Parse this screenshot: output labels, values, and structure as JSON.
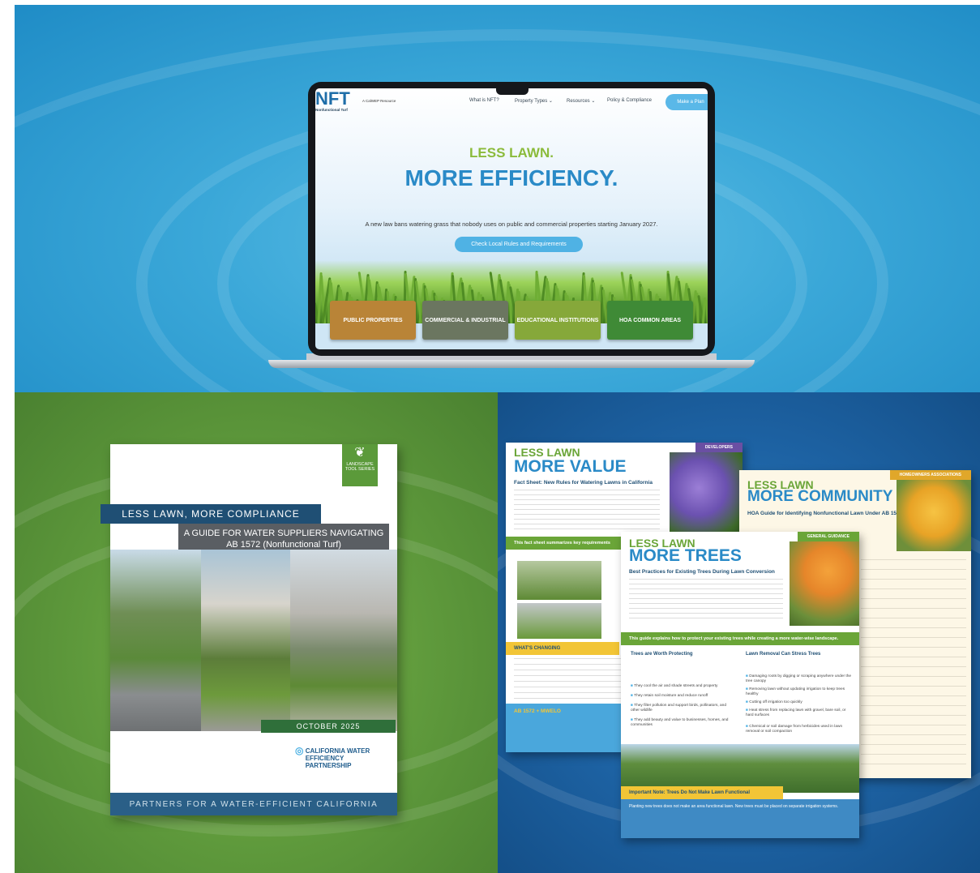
{
  "laptop": {
    "logo_text": "NFT",
    "logo_sub": "Nonfunctional Turf",
    "resource": "A CalWEP Resource",
    "nav": [
      "What is NFT?",
      "Property Types ⌄",
      "Resources ⌄",
      "Policy & Compliance"
    ],
    "plan_button": "Make a Plan",
    "headline_top": "LESS LAWN.",
    "headline_main": "MORE EFFICIENCY.",
    "lede": "A new law bans watering grass that nobody uses on public and commercial properties starting January 2027.",
    "cta": "Check Local Rules and Requirements",
    "cards": [
      "PUBLIC PROPERTIES",
      "COMMERCIAL & INDUSTRIAL",
      "EDUCATIONAL INSTITUTIONS",
      "HOA COMMON AREAS"
    ],
    "card_colors": [
      "#b98437",
      "#6b7660",
      "#86a83a",
      "#3f8a36"
    ]
  },
  "cover": {
    "series": "LANDSCAPE TOOL SERIES",
    "title_band": "LESS LAWN, MORE COMPLIANCE",
    "subtitle": "A GUIDE FOR WATER SUPPLIERS NAVIGATING AB 1572 (Nonfunctional Turf)",
    "date": "OCTOBER 2025",
    "org": "CALIFORNIA WATER EFFICIENCY PARTNERSHIP",
    "footer": "PARTNERS FOR A WATER-EFFICIENT CALIFORNIA"
  },
  "sheets": {
    "value": {
      "tag": "DEVELOPERS",
      "less": "LESS LAWN",
      "more": "MORE VALUE",
      "sub": "Fact Sheet: New Rules for Watering Lawns in California",
      "bar": "This fact sheet summarizes key requirements",
      "changing": "WHAT'S CHANGING",
      "ab": "AB 1572 + MWELO"
    },
    "community": {
      "tag": "HOMEOWNERS ASSOCIATIONS",
      "less": "LESS LAWN",
      "more": "MORE COMMUNITY",
      "sub": "HOA Guide for Identifying Nonfunctional Lawn Under AB 1572"
    },
    "trees": {
      "tag": "GENERAL GUIDANCE",
      "less": "LESS LAWN",
      "more": "MORE TREES",
      "sub": "Best Practices for Existing Trees During Lawn Conversion",
      "bar": "This guide explains how to protect your existing trees while creating a more water-wise landscape.",
      "col1_head": "Trees are Worth Protecting",
      "col2_head": "Lawn Removal Can Stress Trees",
      "col1": [
        "They cool the air and shade streets and property",
        "They retain soil moisture and reduce runoff",
        "They filter pollution and support birds, pollinators, and other wildlife",
        "They add beauty and value to businesses, homes, and communities"
      ],
      "col2": [
        "Damaging roots by digging or scraping anywhere under the tree canopy",
        "Removing lawn without updating irrigation to keep trees healthy",
        "Cutting off irrigation too quickly",
        "Heat stress from replacing lawn with gravel, bare soil, or hard surfaces",
        "Chemical or soil damage from herbicides used in lawn removal or soil compaction"
      ],
      "note_head": "Important Note: Trees Do Not Make Lawn Functional",
      "note_body": "Planting new trees does not make an area functional lawn. New trees must be placed on separate irrigation systems."
    }
  }
}
